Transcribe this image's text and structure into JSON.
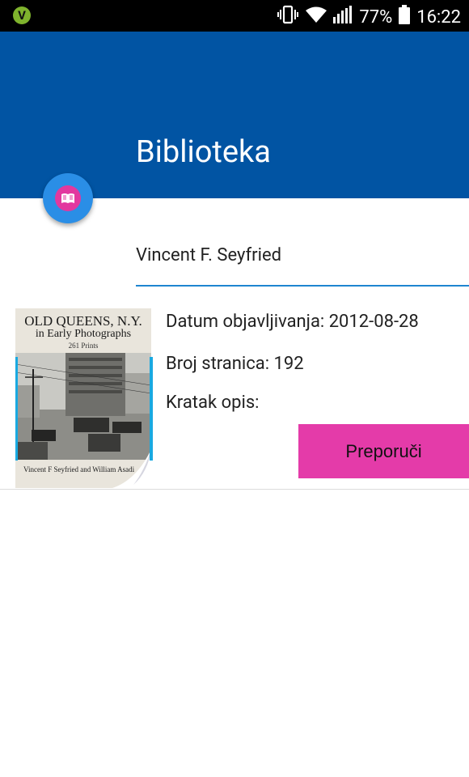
{
  "status_bar": {
    "battery": "77%",
    "time": "16:22",
    "app_badge": "V"
  },
  "app_bar": {
    "title": "Biblioteka",
    "fab_icon": "book-open-icon",
    "color": "#0154a3"
  },
  "book": {
    "author": "Vincent F. Seyfried",
    "published_label": "Datum objavljivanja: 2012-08-28",
    "pages_label": "Broj stranica: 192",
    "description_label": "Kratak opis:",
    "recommend_button": "Preporuči",
    "cover": {
      "title": "OLD QUEENS, N.Y.",
      "subtitle": "in Early Photographs",
      "prints": "261 Prints",
      "authors": "Vincent F Seyfried and William Asadi"
    }
  },
  "colors": {
    "accent": "#e43ba9",
    "fab": "#2a8ee6",
    "underline": "#1f86d0"
  }
}
